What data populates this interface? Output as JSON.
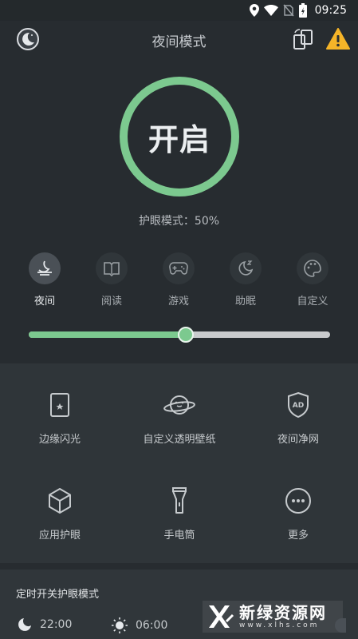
{
  "status_bar": {
    "time": "09:25",
    "icons": [
      "location-icon",
      "wifi-icon",
      "no-sim-icon",
      "battery-charging-icon"
    ]
  },
  "app_bar": {
    "title": "夜间模式",
    "left_icon": "moon-icon",
    "right_icons": [
      "screen-rotate-icon",
      "warning-icon"
    ]
  },
  "power": {
    "label": "开启"
  },
  "eye_mode": {
    "text": "护眼模式：50%"
  },
  "modes": [
    {
      "label": "夜间",
      "icon": "night-icon",
      "active": true
    },
    {
      "label": "阅读",
      "icon": "book-icon",
      "active": false
    },
    {
      "label": "游戏",
      "icon": "gamepad-icon",
      "active": false
    },
    {
      "label": "助眠",
      "icon": "sleep-moon-icon",
      "active": false
    },
    {
      "label": "自定义",
      "icon": "palette-icon",
      "active": false
    }
  ],
  "slider": {
    "value": 0.52
  },
  "tools": [
    {
      "label": "边缘闪光",
      "icon": "edge-flash-icon"
    },
    {
      "label": "自定义透明壁纸",
      "icon": "planet-face-icon"
    },
    {
      "label": "夜间净网",
      "icon": "ad-shield-icon"
    },
    {
      "label": "应用护眼",
      "icon": "cube-icon"
    },
    {
      "label": "手电筒",
      "icon": "flashlight-icon"
    },
    {
      "label": "更多",
      "icon": "more-icon"
    }
  ],
  "timer": {
    "title": "定时开关护眼模式",
    "start": "22:00",
    "end": "06:00"
  },
  "watermark": {
    "main": "新绿资源网",
    "sub": "www.xlhs.com"
  },
  "colors": {
    "accent": "#7cc98f",
    "background": "#272c30",
    "panel": "#2f3539",
    "warning": "#f5b428"
  }
}
